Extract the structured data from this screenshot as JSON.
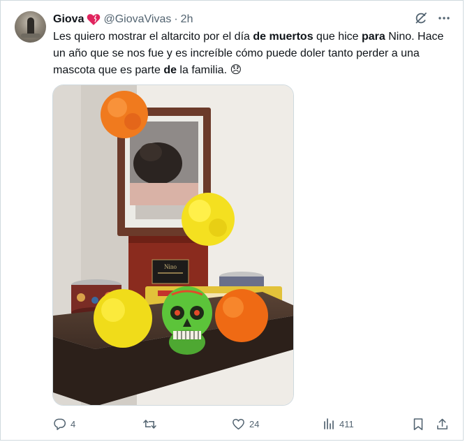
{
  "tweet": {
    "author_name": "Giova",
    "handle": "@GiovaVivas",
    "separator": "·",
    "time": "2h",
    "text_parts": [
      {
        "text": "Les quiero mostrar el altarcito por el día ",
        "bold": false
      },
      {
        "text": "de muertos",
        "bold": true
      },
      {
        "text": " que hice ",
        "bold": false
      },
      {
        "text": "para",
        "bold": true
      },
      {
        "text": " Nino. Hace un año que se nos fue y es increíble cómo puede doler tanto perder a una mascota que es parte ",
        "bold": false
      },
      {
        "text": "de",
        "bold": true
      },
      {
        "text": " la familia. ",
        "bold": false
      },
      {
        "text": "😞",
        "bold": false
      }
    ],
    "plaque_text": "Nino"
  },
  "icons": {
    "heart_emoji": "heart-emoji-icon",
    "grok": "grok-icon",
    "more": "more-icon",
    "reply": "reply-icon",
    "repost": "repost-icon",
    "like": "like-icon",
    "views": "views-icon",
    "bookmark": "bookmark-icon",
    "share": "share-icon"
  },
  "actions": {
    "replies": "4",
    "reposts": "",
    "likes": "24",
    "views": "411"
  },
  "colors": {
    "text": "#0f1419",
    "muted": "#536471",
    "border": "#cfd9de",
    "heart": "#e0245e"
  }
}
